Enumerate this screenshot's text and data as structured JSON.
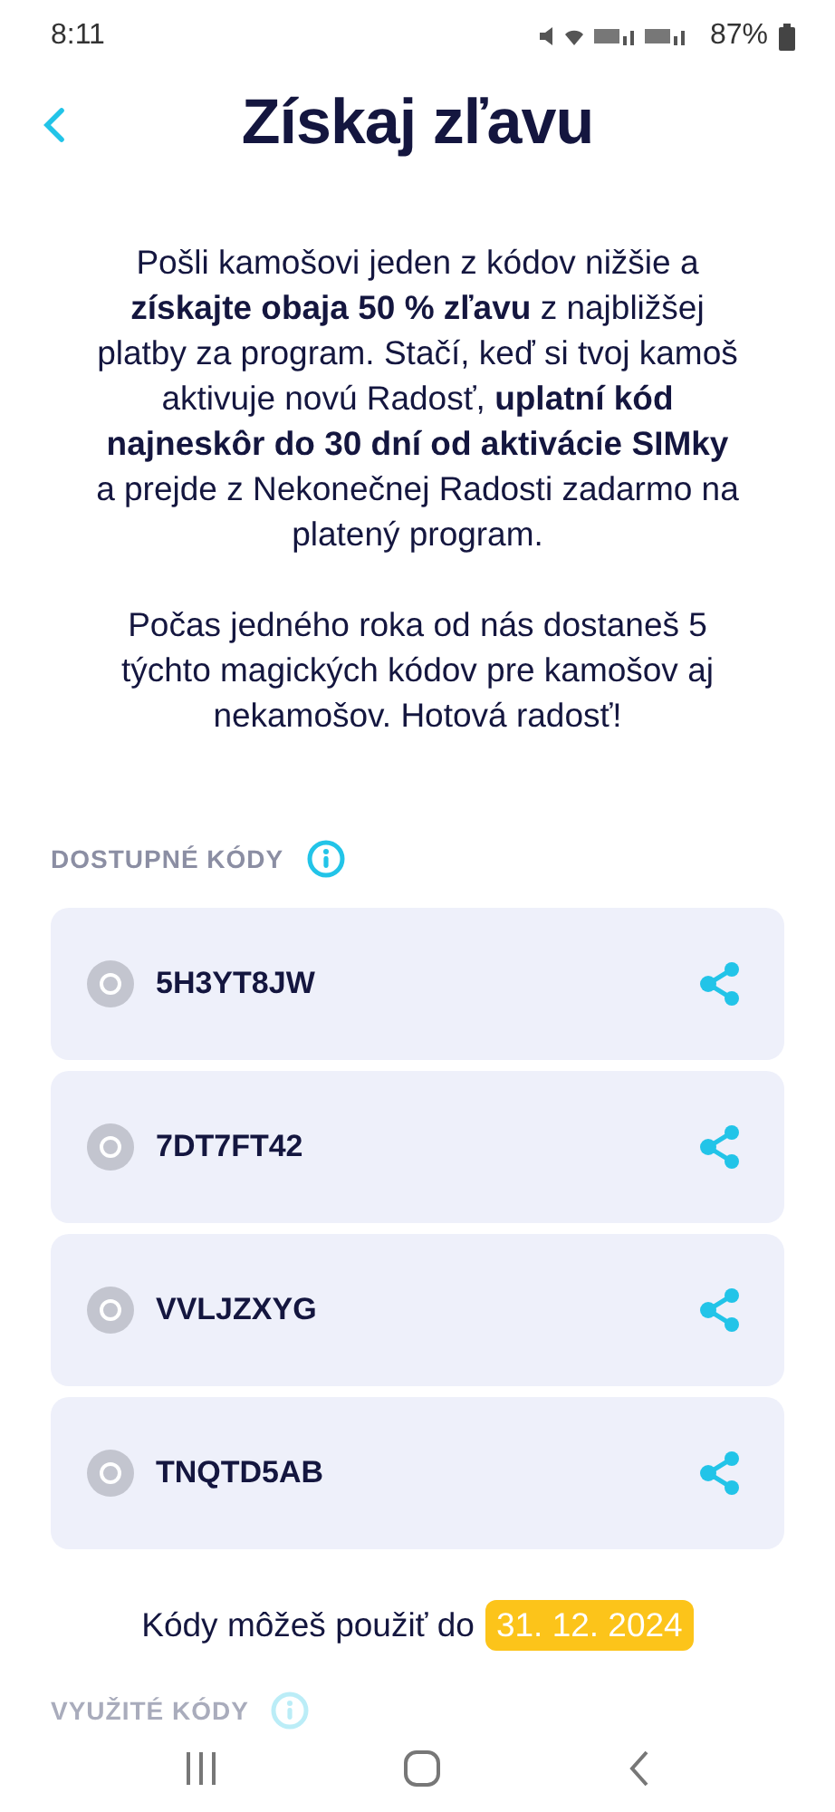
{
  "status_bar": {
    "time": "8:11",
    "battery": "87%"
  },
  "header": {
    "title": "Získaj zľavu"
  },
  "intro": [
    "Pošli kamošovi jeden z kódov nižšie a **získajte obaja 50 % zľavu** z najbližšej platby za program. Stačí, keď si tvoj kamoš aktivuje novú Radosť, **uplatní kód najneskôr do 30 dní od aktivácie SIMky** a prejde z Nekonečnej Radosti zadarmo na platený program.",
    "Počas jedného roka od nás dostaneš 5 týchto magických kódov pre kamošov aj nekamošov. Hotová radosť!"
  ],
  "available": {
    "label": "DOSTUPNÉ KÓDY",
    "codes": [
      {
        "code": "5H3YT8JW",
        "selected": false
      },
      {
        "code": "7DT7FT42",
        "selected": false
      },
      {
        "code": "VVLJZXYG",
        "selected": false
      },
      {
        "code": "TNQTD5AB",
        "selected": false
      }
    ]
  },
  "validity": {
    "text": "Kódy môžeš použiť do",
    "date": "31. 12. 2024"
  },
  "used": {
    "label": "VYUŽITÉ KÓDY"
  }
}
